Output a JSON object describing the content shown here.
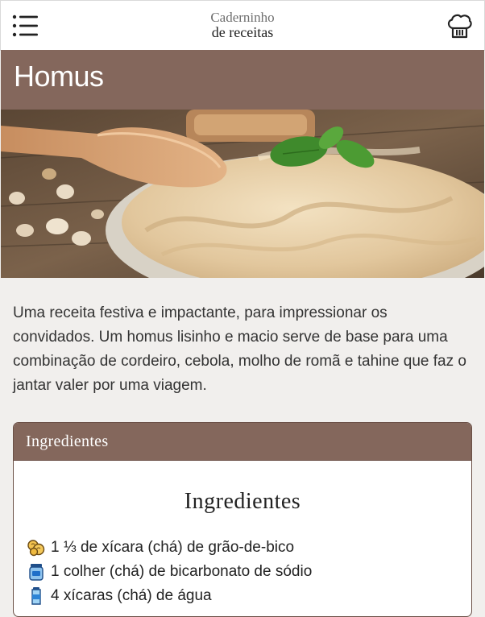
{
  "header": {
    "brand_line1": "Caderninho",
    "brand_line2": "de receitas",
    "menu_icon": "hamburger-menu-icon",
    "profile_icon": "chef-hat-icon"
  },
  "recipe": {
    "title": "Homus",
    "description": "Uma receita festiva e impactante, para impressionar os convidados. Um homus lisinho e macio serve de base para uma combinação de cordeiro, cebola, molho de romã e tahine que faz o jantar valer por uma viagem."
  },
  "ingredients_card": {
    "header": "Ingredientes",
    "title": "Ingredientes",
    "items": [
      {
        "icon": "chickpea-icon",
        "text": "1 ⅓ de xícara (chá) de grão-de-bico"
      },
      {
        "icon": "baking-soda-jar-icon",
        "text": "1 colher (chá) de bicarbonato de sódio"
      },
      {
        "icon": "water-bottle-icon",
        "text": "4 xícaras (chá) de água"
      }
    ]
  },
  "colors": {
    "accent_brown": "#84675c",
    "background": "#f1efed"
  }
}
